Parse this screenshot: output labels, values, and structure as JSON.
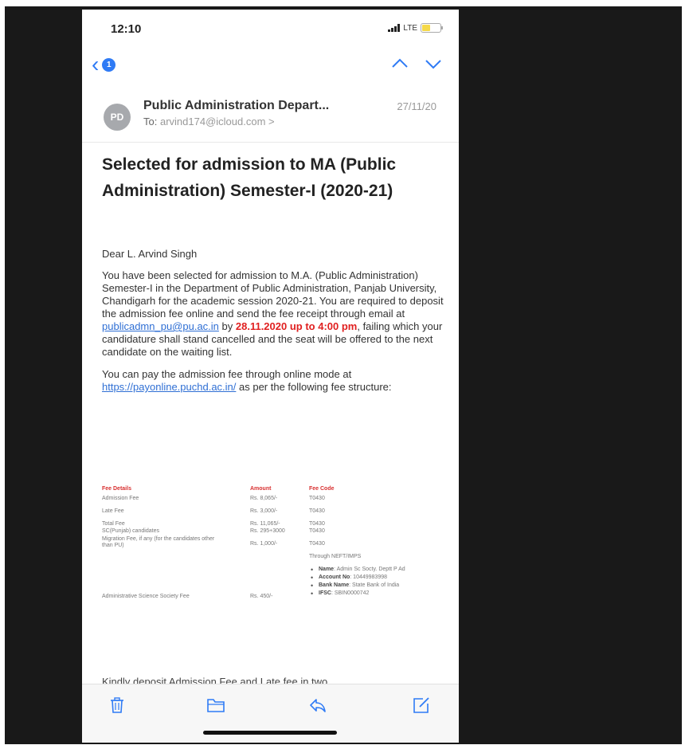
{
  "status_bar": {
    "time": "12:10",
    "network": "LTE",
    "battery_level": 0.5
  },
  "nav": {
    "unread_count": "1"
  },
  "header": {
    "avatar_initials": "PD",
    "sender": "Public Administration Depart...",
    "date": "27/11/20",
    "to_label": "To:",
    "to_address": "arvind174@icloud.com >"
  },
  "email": {
    "subject": "Selected for admission to MA (Public Administration) Semester-I (2020-21)",
    "greeting": "Dear L. Arvind Singh",
    "para1_before_email": "You have been selected for admission to M.A. (Public Administration) Semester-I in the Department of Public Administration, Panjab University, Chandigarh for the academic session 2020-21. You are required to deposit the admission fee online and send the fee receipt through email at ",
    "para1_email": "publicadmn_pu@pu.ac.in",
    "para1_by": " by ",
    "para1_deadline": "28.11.2020 up to 4:00 pm",
    "para1_after": ", failing which your candidature shall stand cancelled and the seat will be offered to the next candidate on the waiting list.",
    "para2_before": "You can pay the admission fee through online mode at ",
    "para2_link": "https://payonline.puchd.ac.in/",
    "para2_after": " as per the following fee structure:",
    "cutoff_text": "Kindly deposit Admission Fee and Late fee in two"
  },
  "fee_table": {
    "headers": [
      "Fee Details",
      "Amount",
      "Fee Code"
    ],
    "rows": [
      [
        "Admission Fee",
        "Rs. 8,065/-",
        "T0430"
      ],
      [
        "Late Fee",
        "Rs. 3,000/-",
        "T0430"
      ],
      [
        "Total Fee",
        "Rs. 11,065/-",
        "T0430"
      ],
      [
        "SC(Punjab) candidates",
        "Rs. 295+3000",
        "T0430"
      ],
      [
        "Migration Fee, if any (for the candidates other than PU)",
        "Rs. 1,000/-",
        "T0430"
      ]
    ],
    "through": "Through NEFT/IMPS",
    "society_fee_label": "Administrative Science Society Fee",
    "society_fee_amount": "Rs. 450/-",
    "bank_details": [
      {
        "key": "Name",
        "value": ": Admin Sc Socty. Deptt P Ad"
      },
      {
        "key": "Account No",
        "value": ": 10449983998"
      },
      {
        "key": "Bank Name",
        "value": ": State Bank of India"
      },
      {
        "key": "IFSC",
        "value": ": SBIN0000742"
      }
    ]
  },
  "icons": {
    "back": "chevron-left-icon",
    "prev": "chevron-up-icon",
    "next": "chevron-down-icon",
    "trash": "trash-icon",
    "folder": "folder-icon",
    "reply": "reply-icon",
    "compose": "compose-icon"
  },
  "colors": {
    "accent": "#2f7bf5",
    "deadline": "#e02020",
    "table_header": "#d83030"
  }
}
